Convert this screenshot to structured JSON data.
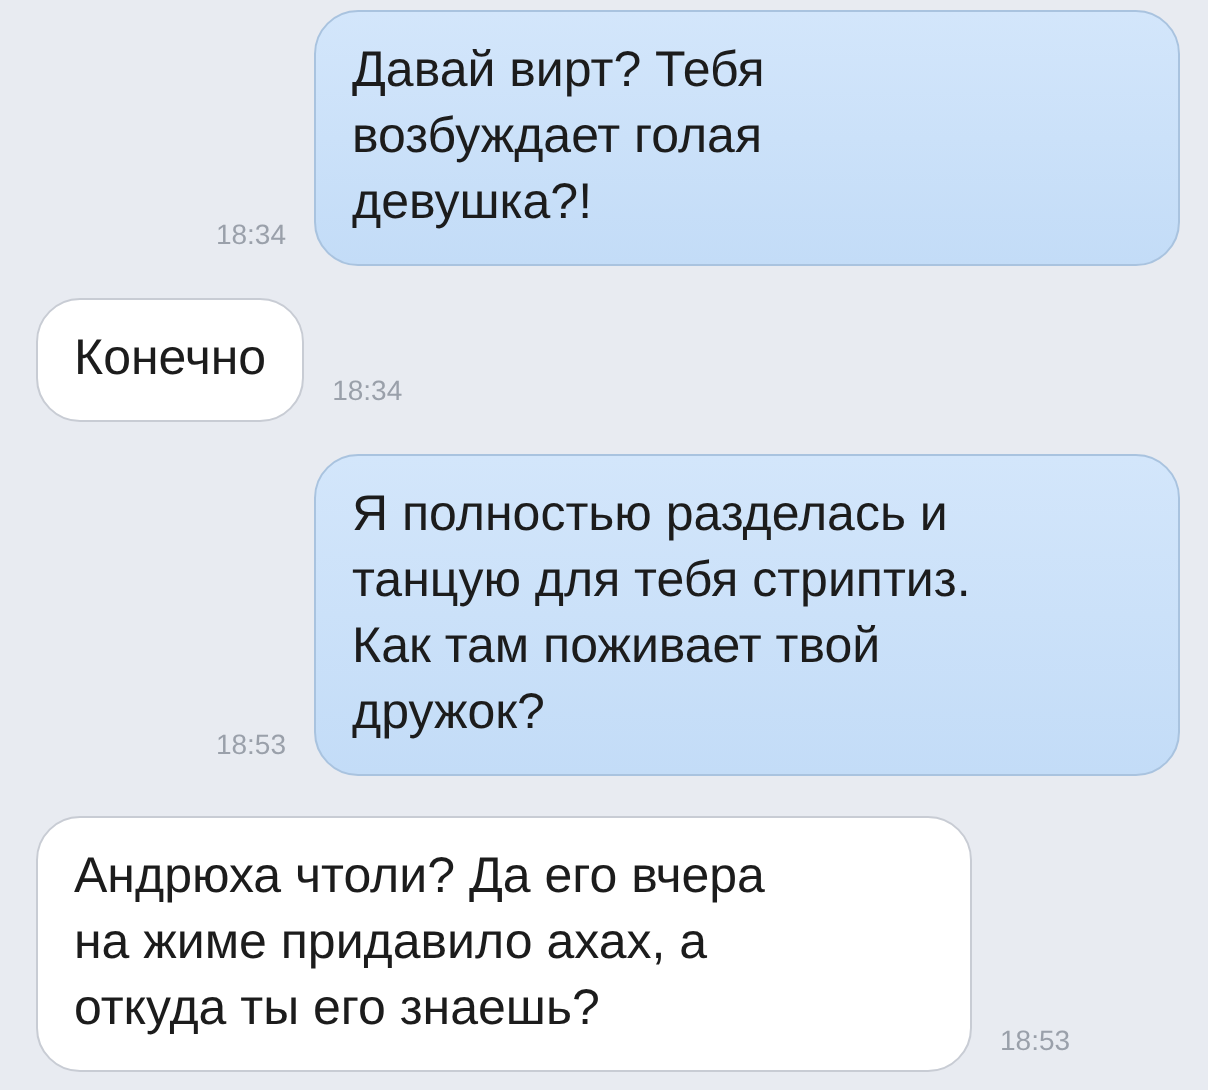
{
  "messages": [
    {
      "kind": "outgoing",
      "text": "Давай вирт? Тебя\nвозбуждает голая\nдевушка?!",
      "time": "18:34"
    },
    {
      "kind": "incoming",
      "text": "Конечно",
      "time": "18:34"
    },
    {
      "kind": "outgoing",
      "text": "Я полностью разделась и\nтанцую для тебя стриптиз.\nКак там поживает твой\nдружок?",
      "time": "18:53"
    },
    {
      "kind": "incoming",
      "text": "Андрюха чтоли? Да его вчера\nна жиме придавило ахах, а\nоткуда ты его знаешь?",
      "time": "18:53"
    }
  ]
}
